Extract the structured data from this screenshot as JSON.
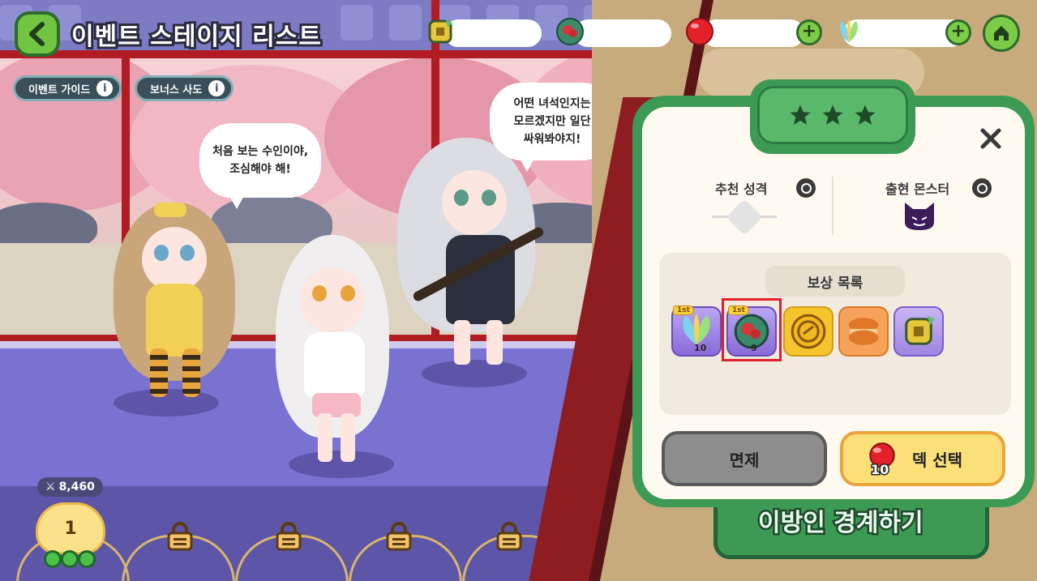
{
  "header": {
    "back_icon": "chevron-left-icon",
    "title": "이벤트 스테이지 리스트",
    "resources": [
      {
        "icon": "gold-bell-icon",
        "value": ""
      },
      {
        "icon": "rose-orb-icon",
        "value": ""
      },
      {
        "icon": "red-candy-icon",
        "value": ""
      },
      {
        "icon": "leaf-crystal-icon",
        "value": ""
      }
    ],
    "home_icon": "home-icon"
  },
  "guides": {
    "event_guide": "이벤트 가이드",
    "bonus_sado": "보너스 사도"
  },
  "speech": {
    "left": "처음 보는 수인이야,\n조심해야 해!",
    "right": "어떤 녀석인지는\n모르겠지만 일단\n싸워봐야지!"
  },
  "stage_track": {
    "power": "8,460",
    "current_stage": "1",
    "locked_count": 4
  },
  "dialog": {
    "stars": 3,
    "recommended_label": "추천 성격",
    "monster_label": "출현 몬스터",
    "reward_title": "보상 목록",
    "rewards": [
      {
        "name": "leaf-crystal",
        "badge": "1st",
        "qty": "10"
      },
      {
        "name": "rose-orb",
        "badge": "1st",
        "qty": "9"
      },
      {
        "name": "gold-coin",
        "badge": "",
        "qty": ""
      },
      {
        "name": "macaron",
        "badge": "",
        "qty": ""
      },
      {
        "name": "gold-bell",
        "badge": "",
        "qty": ""
      }
    ],
    "dismiss_button": "면제",
    "deck_button": "덱 선택",
    "deck_cost": "10"
  },
  "banner_text": "이방인 경계하기",
  "colors": {
    "accent_green": "#3d9a55",
    "highlight_red": "#e0202a",
    "button_yellow": "#fbe07a"
  }
}
